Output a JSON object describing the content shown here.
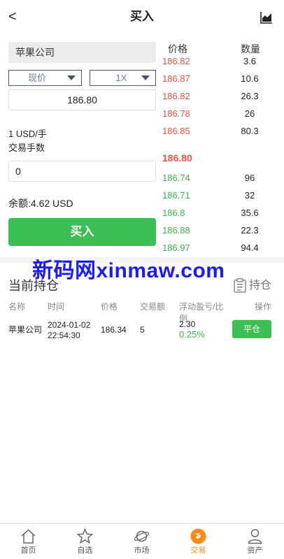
{
  "header": {
    "back": "<",
    "title": "买入"
  },
  "form": {
    "symbol": "苹果公司",
    "order_type": "现价",
    "leverage": "1X",
    "price": "186.80",
    "unit_line1": "1 USD/手",
    "unit_line2": "交易手数",
    "quantity": "0",
    "balance": "余额:4.62 USD",
    "buy_label": "买入"
  },
  "orderbook": {
    "price_header": "价格",
    "qty_header": "数量",
    "asks": [
      {
        "price": "186.82",
        "qty": "3.6"
      },
      {
        "price": "186.87",
        "qty": "10.6"
      },
      {
        "price": "186.82",
        "qty": "26.3"
      },
      {
        "price": "186.78",
        "qty": "26"
      },
      {
        "price": "186.85",
        "qty": "80.3"
      }
    ],
    "mid": "186.80",
    "bids": [
      {
        "price": "186.74",
        "qty": "96"
      },
      {
        "price": "186.71",
        "qty": "32"
      },
      {
        "price": "186.8",
        "qty": "35.6"
      },
      {
        "price": "186.88",
        "qty": "22.3"
      },
      {
        "price": "186.97",
        "qty": "94.4"
      }
    ]
  },
  "watermark": "新码网xinmaw.com",
  "positions": {
    "title": "当前持仓",
    "link": "持仓",
    "columns": [
      "名称",
      "时间",
      "价格",
      "交易额",
      "浮动盈亏/比",
      "例",
      "操作"
    ],
    "row": {
      "name": "苹果公司",
      "date": "2024-01-02",
      "time": "22:54:30",
      "price": "186.34",
      "amount": "5",
      "pnl": "2.30",
      "pnl_pct": "0.25%",
      "action": "平仓"
    }
  },
  "tabbar": {
    "items": [
      {
        "label": "首页",
        "icon": "home-icon"
      },
      {
        "label": "自选",
        "icon": "star-icon"
      },
      {
        "label": "市场",
        "icon": "planet-icon"
      },
      {
        "label": "交易",
        "icon": "trade-icon"
      },
      {
        "label": "资产",
        "icon": "user-icon"
      }
    ]
  },
  "colors": {
    "buy": "#3cbf54",
    "ask": "#e8553e",
    "bid": "#3cb549",
    "active_tab": "#ff8a1a",
    "watermark": "#1a1aff"
  }
}
